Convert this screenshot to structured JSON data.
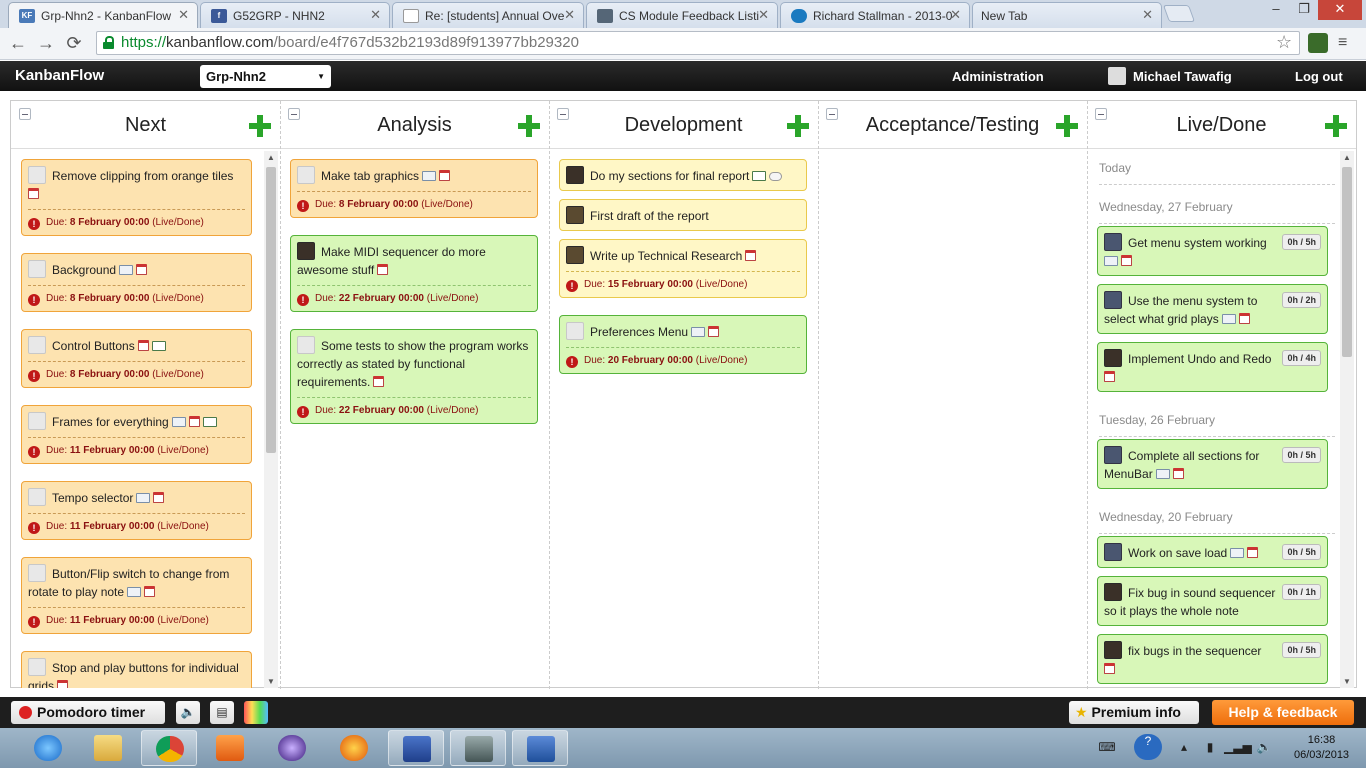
{
  "browser": {
    "tabs": [
      {
        "title": "Grp-Nhn2 - KanbanFlow",
        "favicon": "KF",
        "active": true
      },
      {
        "title": "G52GRP - NHN2",
        "favicon": "f",
        "active": false
      },
      {
        "title": "Re: [students] Annual Ove",
        "favicon": "doc",
        "active": false
      },
      {
        "title": "CS Module Feedback Listi",
        "favicon": "page",
        "active": false
      },
      {
        "title": "Richard Stallman - 2013-0",
        "favicon": "drupal",
        "active": false
      },
      {
        "title": "New Tab",
        "favicon": "",
        "active": false
      }
    ],
    "url_scheme": "https://",
    "url_host": "kanbanflow.com",
    "url_path": "/board/e4f767d532b2193d89f913977bb29320",
    "nav": {
      "back": "←",
      "forward": "→",
      "reload": "⟳"
    },
    "window_controls": {
      "minimize": "–",
      "maximize": "❐",
      "close": "✕"
    }
  },
  "app": {
    "logo": "KanbanFlow",
    "board_name": "Grp-Nhn2",
    "admin_link": "Administration",
    "user_name": "Michael Tawafig",
    "logout": "Log out"
  },
  "columns": [
    {
      "title": "Next"
    },
    {
      "title": "Analysis"
    },
    {
      "title": "Development"
    },
    {
      "title": "Acceptance/Testing"
    },
    {
      "title": "Live/Done"
    }
  ],
  "next_cards": [
    {
      "title": "Remove clipping from orange tiles",
      "due_date": "8 February 00:00",
      "swimlane": "(Live/Done)"
    },
    {
      "title": "Background",
      "due_date": "8 February 00:00",
      "swimlane": "(Live/Done)"
    },
    {
      "title": "Control Buttons",
      "due_date": "8 February 00:00",
      "swimlane": "(Live/Done)"
    },
    {
      "title": "Frames for everything",
      "due_date": "11 February 00:00",
      "swimlane": "(Live/Done)"
    },
    {
      "title": "Tempo selector",
      "due_date": "11 February 00:00",
      "swimlane": "(Live/Done)"
    },
    {
      "title": "Button/Flip switch to change from rotate to play note",
      "due_date": "11 February 00:00",
      "swimlane": "(Live/Done)"
    },
    {
      "title": "Stop and play buttons for individual grids"
    }
  ],
  "analysis_cards": [
    {
      "title": "Make tab graphics",
      "due_date": "8 February 00:00",
      "swimlane": "(Live/Done)"
    },
    {
      "title": "Make MIDI sequencer do more awesome stuff",
      "due_date": "22 February 00:00",
      "swimlane": "(Live/Done)"
    },
    {
      "title": "Some tests to show the program works correctly as stated by functional requirements.",
      "due_date": "22 February 00:00",
      "swimlane": "(Live/Done)"
    }
  ],
  "development_cards": [
    {
      "title": "Do my sections for final report"
    },
    {
      "title": "First draft of the report"
    },
    {
      "title": "Write up Technical Research",
      "due_date": "15 February 00:00",
      "swimlane": "(Live/Done)"
    },
    {
      "title": "Preferences Menu",
      "due_date": "20 February 00:00",
      "swimlane": "(Live/Done)"
    }
  ],
  "due_label": "Due:",
  "done": {
    "today": "Today",
    "groups": [
      {
        "date": "Wednesday, 27 February"
      },
      {
        "date": "Tuesday, 26 February"
      },
      {
        "date": "Wednesday, 20 February"
      }
    ],
    "cards": [
      {
        "title": "Get menu system working",
        "time": "0h / 5h"
      },
      {
        "title": "Use the menu system to select what grid plays",
        "time": "0h / 2h"
      },
      {
        "title": "Implement Undo and Redo",
        "time": "0h / 4h"
      },
      {
        "title": "Complete all sections for MenuBar",
        "time": "0h / 5h"
      },
      {
        "title": "Work on save load",
        "time": "0h / 5h"
      },
      {
        "title": "Fix bug in sound sequencer so it plays the whole note",
        "time": "0h / 1h"
      },
      {
        "title": "fix bugs in the sequencer",
        "time": "0h / 5h"
      }
    ]
  },
  "bottom": {
    "pomodoro": "Pomodoro timer",
    "premium": "Premium info",
    "help": "Help & feedback"
  },
  "taskbar": {
    "time": "16:38",
    "date": "06/03/2013"
  },
  "colors": {
    "orange_card": "#fde3b0",
    "green_card": "#d8f7b8",
    "yellow_card": "#fff7c6",
    "add_green": "#2aa52a",
    "due_red": "#8a1010",
    "help_orange": "#ee6e0c"
  }
}
